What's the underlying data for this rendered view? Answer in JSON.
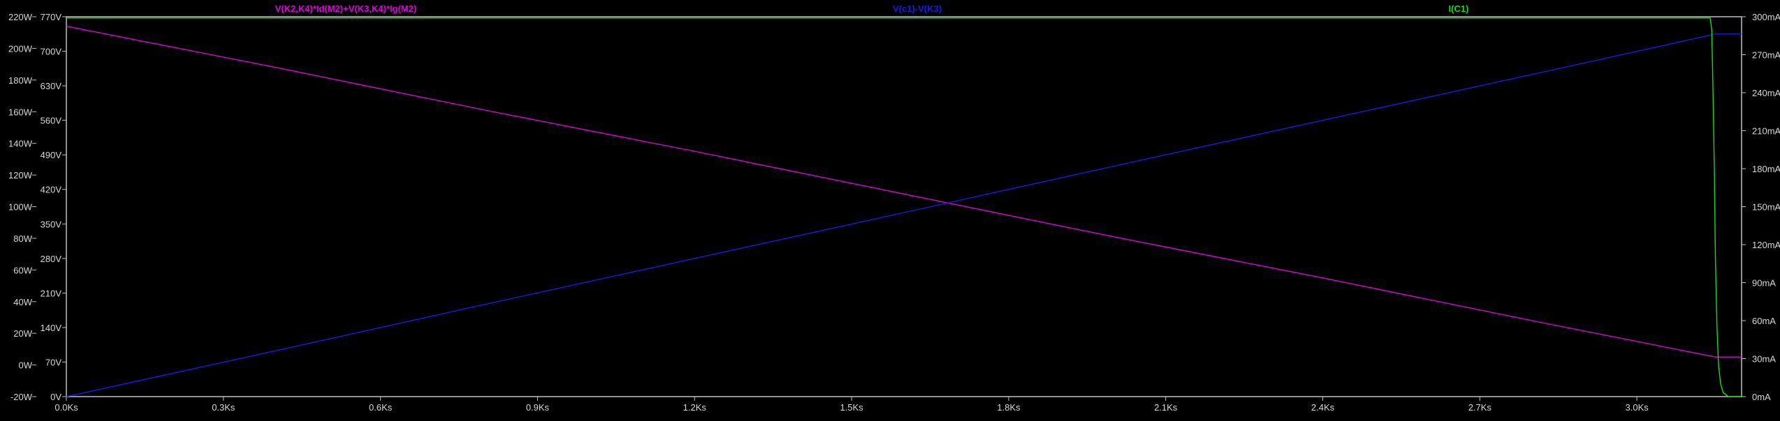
{
  "window": {
    "background_color": "#000000",
    "frame_color": "#c0c0c0",
    "axis_text_color": "#d8d8d8"
  },
  "chart_data": {
    "type": "line",
    "title": "",
    "xlabel": "",
    "x_unit": "Ks",
    "xlim": [
      0.0,
      3.2
    ],
    "x_ticks": [
      "0.0Ks",
      "0.3Ks",
      "0.6Ks",
      "0.9Ks",
      "1.2Ks",
      "1.5Ks",
      "1.8Ks",
      "2.1Ks",
      "2.4Ks",
      "2.7Ks",
      "3.0Ks"
    ],
    "x_tick_values": [
      0.0,
      0.3,
      0.6,
      0.9,
      1.2,
      1.5,
      1.8,
      2.1,
      2.4,
      2.7,
      3.0
    ],
    "y_axes": [
      {
        "id": "power",
        "side": "left-outer",
        "unit": "W",
        "range": [
          -20,
          220
        ],
        "ticks": [
          "-20W",
          "0W",
          "20W",
          "40W",
          "60W",
          "80W",
          "100W",
          "120W",
          "140W",
          "160W",
          "180W",
          "200W",
          "220W"
        ],
        "tick_values": [
          -20,
          0,
          20,
          40,
          60,
          80,
          100,
          120,
          140,
          160,
          180,
          200,
          220
        ]
      },
      {
        "id": "voltage",
        "side": "left-inner",
        "unit": "V",
        "range": [
          0,
          770
        ],
        "ticks": [
          "0V",
          "70V",
          "140V",
          "210V",
          "280V",
          "350V",
          "420V",
          "490V",
          "560V",
          "630V",
          "700V",
          "770V"
        ],
        "tick_values": [
          0,
          70,
          140,
          210,
          280,
          350,
          420,
          490,
          560,
          630,
          700,
          770
        ]
      },
      {
        "id": "current",
        "side": "right",
        "unit": "mA",
        "range": [
          0,
          300
        ],
        "ticks": [
          "0mA",
          "30mA",
          "60mA",
          "90mA",
          "120mA",
          "150mA",
          "180mA",
          "210mA",
          "240mA",
          "270mA",
          "300mA"
        ],
        "tick_values": [
          0,
          30,
          60,
          90,
          120,
          150,
          180,
          210,
          240,
          270,
          300
        ]
      }
    ],
    "series": [
      {
        "name": "V(K2,K4)*Id(M2)+V(K3,K4)*Ig(M2)",
        "axis": "power",
        "color": "#e000e0",
        "x": [
          0.0,
          0.4,
          0.8,
          1.2,
          1.6,
          2.0,
          2.4,
          2.8,
          3.15,
          3.2
        ],
        "y": [
          214,
          188,
          161,
          135,
          108,
          81,
          55,
          28,
          5,
          5
        ]
      },
      {
        "name": "V(c1)-V(K3)",
        "axis": "voltage",
        "color": "#1a1ae8",
        "x": [
          0.0,
          0.4,
          0.8,
          1.2,
          1.6,
          2.0,
          2.4,
          2.8,
          3.15,
          3.2
        ],
        "y": [
          0,
          93,
          187,
          280,
          373,
          467,
          560,
          653,
          735,
          735
        ]
      },
      {
        "name": "I(C1)",
        "axis": "current",
        "color": "#10e010",
        "x": [
          0.0,
          3.0,
          3.14,
          3.143,
          3.145,
          3.148,
          3.15,
          3.153,
          3.156,
          3.16,
          3.165,
          3.175,
          3.2
        ],
        "y": [
          299,
          299,
          299,
          290,
          250,
          180,
          110,
          55,
          25,
          10,
          3,
          0,
          0
        ]
      }
    ]
  }
}
